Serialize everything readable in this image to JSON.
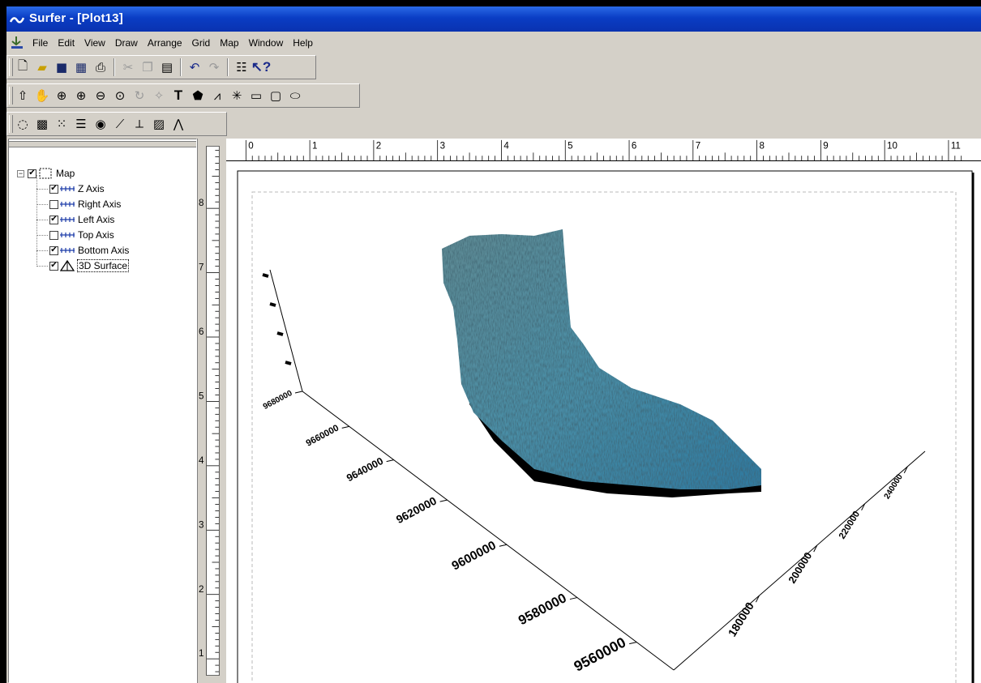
{
  "window": {
    "title": "Surfer - [Plot13]"
  },
  "menu": {
    "items": [
      "File",
      "Edit",
      "View",
      "Draw",
      "Arrange",
      "Grid",
      "Map",
      "Window",
      "Help"
    ]
  },
  "toolbars": {
    "standard": [
      "new-icon",
      "open-icon",
      "save-icon",
      "worksheet-icon",
      "print-icon",
      "cut-icon",
      "copy-icon",
      "paste-icon",
      "undo-icon",
      "redo-icon",
      "object-manager-icon",
      "context-help-icon"
    ],
    "draw": [
      "select-icon",
      "pan-icon",
      "zoom-rectangle-icon",
      "zoom-in-icon",
      "zoom-out-icon",
      "zoom-page-icon",
      "rotate-icon",
      "reshape-icon",
      "text-icon",
      "polygon-icon",
      "polyline-icon",
      "symbol-icon",
      "rectangle-icon",
      "rounded-rectangle-icon",
      "ellipse-icon"
    ],
    "map": [
      "contour-map-icon",
      "image-map-icon",
      "post-map-icon",
      "classed-post-icon",
      "shaded-relief-icon",
      "vector-map-icon",
      "base-map-icon",
      "wireframe-icon",
      "surface-icon"
    ]
  },
  "object_manager": {
    "root": {
      "label": "Map",
      "checked": true
    },
    "items": [
      {
        "label": "Z Axis",
        "checked": true,
        "icon": "axis-icon"
      },
      {
        "label": "Right Axis",
        "checked": false,
        "icon": "axis-icon"
      },
      {
        "label": "Left Axis",
        "checked": true,
        "icon": "axis-icon"
      },
      {
        "label": "Top Axis",
        "checked": false,
        "icon": "axis-icon"
      },
      {
        "label": "Bottom Axis",
        "checked": true,
        "icon": "axis-icon"
      },
      {
        "label": "3D Surface",
        "checked": true,
        "icon": "surface-icon",
        "selected": true
      }
    ]
  },
  "rulers": {
    "horizontal": [
      "0",
      "1",
      "2",
      "3",
      "4",
      "5",
      "6",
      "7",
      "8",
      "9",
      "10",
      "11"
    ],
    "vertical": [
      "8",
      "7",
      "6",
      "5",
      "4",
      "3",
      "2",
      "1"
    ]
  },
  "plot": {
    "left_axis_ticks": [
      "9680000",
      "9660000",
      "9640000",
      "9620000",
      "9600000",
      "9580000",
      "9560000"
    ],
    "bottom_axis_ticks": [
      "180000",
      "200000",
      "220000",
      "240000"
    ],
    "surface_color": "#3f7f95",
    "shadow_color": "#000000"
  },
  "colors": {
    "titlebar": "#0a3dc4",
    "face": "#d4d0c8",
    "surface": "#4a8ea6"
  }
}
